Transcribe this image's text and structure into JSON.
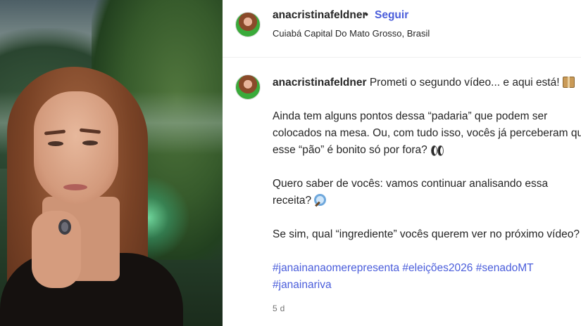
{
  "post": {
    "author": {
      "username": "anacristinafeldner",
      "follow_separator": "•",
      "follow_label": "Seguir",
      "location": "Cuiabá Capital Do Mato Grosso, Brasil"
    },
    "caption": {
      "username": "anacristinafeldner",
      "line1": "Prometi o segundo vídeo... e aqui está!",
      "para2": "Ainda tem alguns pontos dessa “padaria” que podem ser colocados na mesa. Ou, com tudo isso, vocês já perceberam que esse “pão” é bonito só por fora?",
      "para3": "Quero saber de vocês: vamos continuar analisando essa receita?",
      "para4": "Se sim, qual “ingrediente” vocês querem ver no próximo vídeo?",
      "hashtags": [
        "#janainanaomerepresenta",
        "#eleições2026",
        "#senadoMT",
        "#janainariva"
      ]
    },
    "timestamp": "5 d",
    "icons": {
      "line1_emoji": "package-icon",
      "para2_emoji": "eyes-icon",
      "para3_emoji": "magnifier-icon"
    }
  },
  "colors": {
    "link": "#4a5ddb",
    "text": "#262626",
    "muted": "#737373"
  }
}
